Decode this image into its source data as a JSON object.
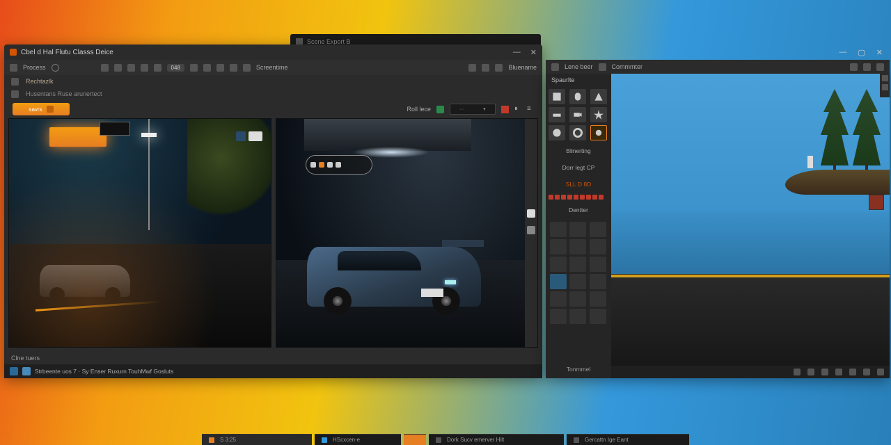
{
  "bg_tab": {
    "label": "Scene Export B"
  },
  "left_window": {
    "title": "Cbel d Hal Flutu Classs Deice",
    "title_controls": {
      "min": "—",
      "close": "✕"
    },
    "menu": {
      "items": [
        "Process"
      ],
      "right_label": "Screentime",
      "far_label": "Bluename",
      "pill": "048"
    },
    "subbar": {
      "label1": "Rechtazlk",
      "label2": "Husentans  Ruse arunertect"
    },
    "toolbar": {
      "orange_label": "savrs",
      "roll_label": "Roll lece",
      "dropdown": "···"
    },
    "status": "Clne tuers",
    "bottom": "Strbeente  uos   7 · Sy  Enser  Ruxurn  TouhMwf Gosluts"
  },
  "right_window": {
    "title_controls": {
      "min": "—",
      "max": "▢",
      "close": "✕"
    },
    "menu": {
      "left": [
        "Lene beer",
        "Commmter"
      ]
    },
    "panel": {
      "header": "Spaurlte",
      "section1": "Blinerting",
      "section2": "Dorr legt CP",
      "section3": "SLL D 8D",
      "section4": "Dentter",
      "footer": "Tonmmel"
    }
  },
  "taskbar": {
    "items": [
      "S 3:25",
      "HScxcen-e",
      "",
      "Dork  Sucv emerver Hilt",
      "Gercattn Ige  Eant"
    ]
  },
  "icons": {
    "search": "search-icon",
    "gear": "gear-icon",
    "menu": "menu-icon",
    "play": "play-icon",
    "pause": "pause-icon",
    "cube": "cube-icon",
    "light": "light-icon",
    "star": "star-icon",
    "folder": "folder-icon"
  }
}
